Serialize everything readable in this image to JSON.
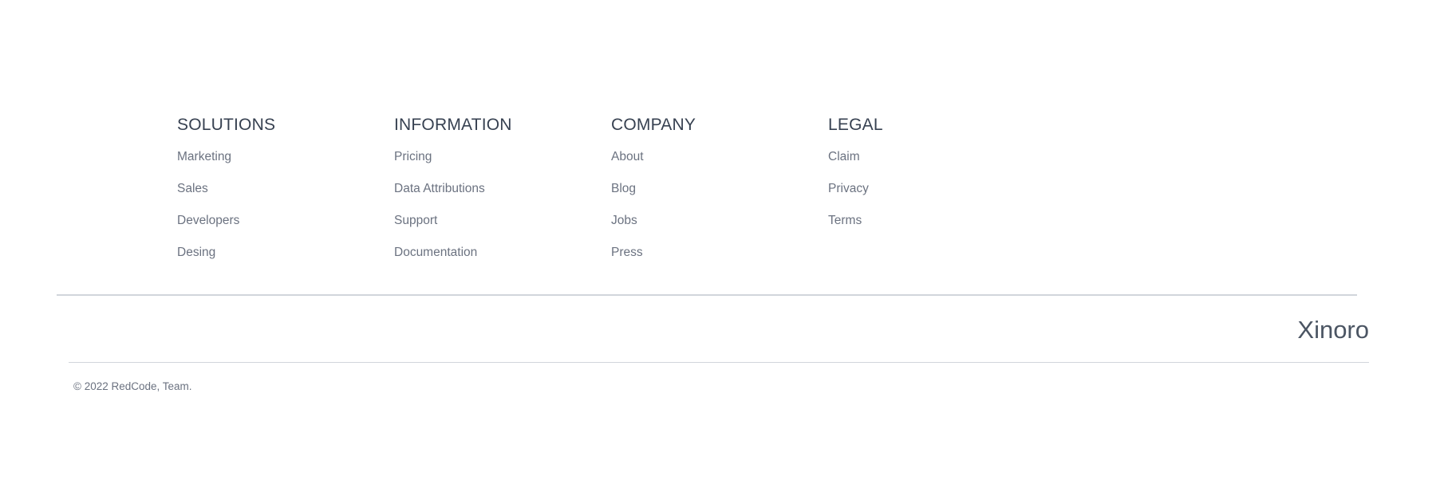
{
  "footer": {
    "columns": [
      {
        "heading": "SOLUTIONS",
        "links": [
          "Marketing",
          "Sales",
          "Developers",
          "Desing"
        ]
      },
      {
        "heading": "INFORMATION",
        "links": [
          "Pricing",
          "Data Attributions",
          "Support",
          "Documentation"
        ]
      },
      {
        "heading": "COMPANY",
        "links": [
          "About",
          "Blog",
          "Jobs",
          "Press"
        ]
      },
      {
        "heading": "LEGAL",
        "links": [
          "Claim",
          "Privacy",
          "Terms"
        ]
      }
    ],
    "brand": "Xinoro",
    "copyright": "© 2022 RedCode, Team."
  },
  "colors": {
    "heading": "#374151",
    "link": "#6b7280",
    "brand": "#4b5563",
    "divider": "#d1d5db",
    "background": "#ffffff"
  }
}
